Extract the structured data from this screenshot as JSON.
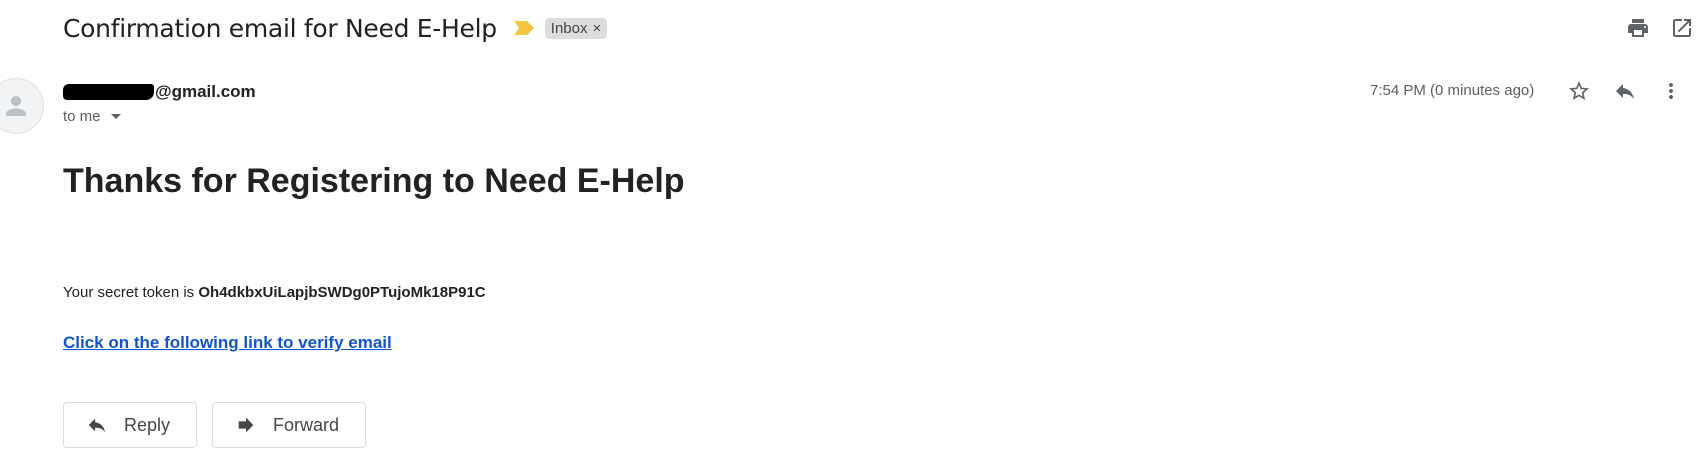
{
  "email": {
    "subject": "Confirmation email for Need E-Help",
    "label": "Inbox",
    "label_close": "×",
    "sender": "@gmail.com",
    "recipient": "to me",
    "time": "7:54 PM (0 minutes ago)"
  },
  "body": {
    "heading": "Thanks for Registering to Need E-Help",
    "token_prefix": "Your secret token is",
    "token": "Oh4dkbxUiLapjbSWDg0PTujoMk18P91C",
    "link_text": "Click on the following link to verify email"
  },
  "actions": {
    "reply": "Reply",
    "forward": "Forward"
  },
  "colors": {
    "importance": "#f4c542",
    "link": "#1155cc"
  },
  "icons": [
    "importance-marker-icon",
    "print-icon",
    "open-in-new-window-icon",
    "star-icon",
    "reply-icon",
    "more-vert-icon",
    "forward-icon",
    "person-icon"
  ]
}
